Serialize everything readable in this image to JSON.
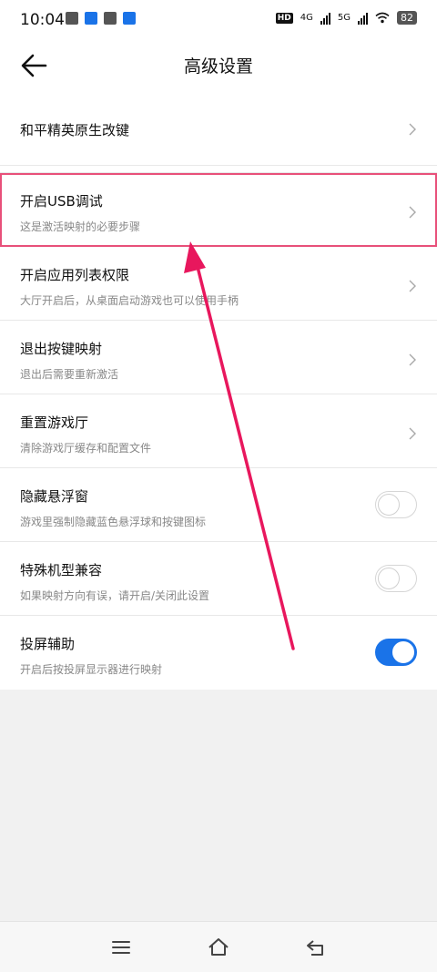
{
  "status_bar": {
    "time": "10:04",
    "network_1": "4G",
    "network_2": "5G",
    "hd_badge": "HD",
    "battery": "82",
    "left_icon_colors": [
      "#555555",
      "#1a73e8",
      "#555555",
      "#1a73e8"
    ]
  },
  "header": {
    "title": "高级设置",
    "back_icon": "arrow-left-icon"
  },
  "settings": {
    "item_0": {
      "title": "和平精英原生改键"
    },
    "item_1": {
      "title": "开启USB调试",
      "subtitle": "这是激活映射的必要步骤"
    },
    "item_2": {
      "title": "开启应用列表权限",
      "subtitle": "大厅开启后，从桌面启动游戏也可以使用手柄"
    },
    "item_3": {
      "title": "退出按键映射",
      "subtitle": "退出后需要重新激活"
    },
    "item_4": {
      "title": "重置游戏厅",
      "subtitle": "清除游戏厅缓存和配置文件"
    },
    "item_5": {
      "title": "隐藏悬浮窗",
      "subtitle": "游戏里强制隐藏蓝色悬浮球和按键图标",
      "enabled": false
    },
    "item_6": {
      "title": "特殊机型兼容",
      "subtitle": "如果映射方向有误，请开启/关闭此设置",
      "enabled": false
    },
    "item_7": {
      "title": "投屏辅助",
      "subtitle": "开启后按投屏显示器进行映射",
      "enabled": true
    }
  },
  "colors": {
    "accent": "#1a73e8",
    "highlight_border": "#e8507a",
    "annotation_arrow": "#e8175d"
  },
  "navbar": {
    "icons": [
      "menu-icon",
      "home-icon",
      "back-nav-icon"
    ]
  }
}
